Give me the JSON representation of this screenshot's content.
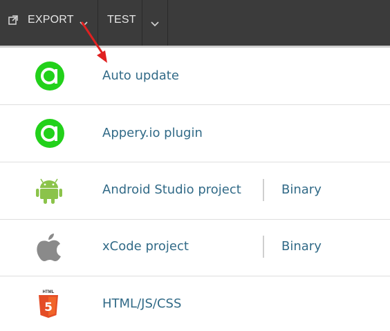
{
  "toolbar": {
    "export_label": "EXPORT",
    "test_label": "TEST",
    "export_icon": "external-link-icon",
    "chevron_icon": "chevron-down-icon"
  },
  "menu": {
    "items": [
      {
        "label": "Auto update",
        "icon": "appery-logo-icon"
      },
      {
        "label": "Appery.io plugin",
        "icon": "appery-logo-icon"
      },
      {
        "label": "Android Studio project",
        "icon": "android-icon",
        "secondary": "Binary"
      },
      {
        "label": "xCode project",
        "icon": "apple-icon",
        "secondary": "Binary"
      },
      {
        "label": "HTML/JS/CSS",
        "icon": "html5-icon"
      }
    ]
  },
  "annotation": {
    "arrow_color": "#e02020"
  },
  "colors": {
    "link": "#316a87",
    "appery_green": "#22d11a",
    "android_green": "#8bc34a",
    "html5_orange": "#e44d26"
  }
}
